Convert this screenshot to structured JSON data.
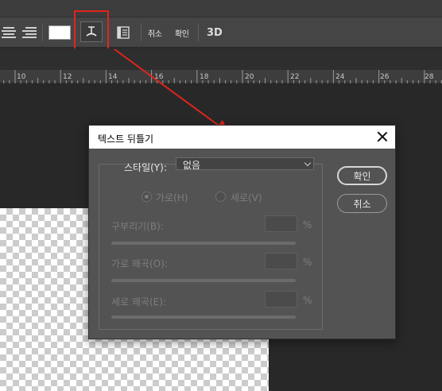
{
  "toolbar": {
    "cancel_label": "취소",
    "confirm_label": "확인",
    "threed_label": "3D",
    "text_color": "#ffffff"
  },
  "ruler": {
    "ticks": [
      "10",
      "12",
      "14",
      "16",
      "18",
      "20",
      "22",
      "24",
      "26",
      "28"
    ]
  },
  "dialog": {
    "title": "텍스트 뒤틀기",
    "style_label": "스타일(Y):",
    "style_value": "없음",
    "orientation": {
      "horizontal_label": "가로(H)",
      "vertical_label": "세로(V)",
      "selected": "horizontal"
    },
    "bend_label": "구부리기(B):",
    "h_distortion_label": "가로 왜곡(O):",
    "v_distortion_label": "세로 왜곡(E):",
    "percent": "%",
    "ok_button": "확인",
    "cancel_button": "취소"
  },
  "colors": {
    "highlight": "#e0251d",
    "panel": "#535353",
    "canvas": "#282828"
  },
  "icons": [
    "align-center-icon",
    "align-right-icon",
    "warp-text-icon",
    "character-panel-icon",
    "close-icon",
    "chevron-down-icon"
  ]
}
